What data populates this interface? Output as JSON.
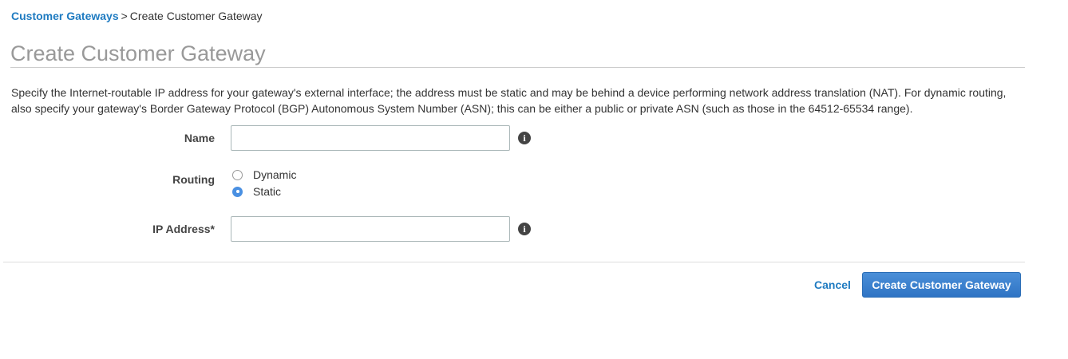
{
  "breadcrumb": {
    "parent": "Customer Gateways",
    "separator": ">",
    "current": "Create Customer Gateway"
  },
  "page": {
    "title": "Create Customer Gateway",
    "description": "Specify the Internet-routable IP address for your gateway's external interface; the address must be static and may be behind a device performing network address translation (NAT). For dynamic routing, also specify your gateway's Border Gateway Protocol (BGP) Autonomous System Number (ASN); this can be either a public or private ASN (such as those in the 64512-65534 range)."
  },
  "form": {
    "name": {
      "label": "Name",
      "value": "",
      "info_icon": "info-icon"
    },
    "routing": {
      "label": "Routing",
      "options": [
        {
          "label": "Dynamic",
          "selected": false
        },
        {
          "label": "Static",
          "selected": true
        }
      ]
    },
    "ip_address": {
      "label": "IP Address*",
      "value": "",
      "info_icon": "info-icon"
    }
  },
  "actions": {
    "cancel_label": "Cancel",
    "submit_label": "Create Customer Gateway"
  },
  "colors": {
    "link": "#1f7bc1",
    "primary_button": "#2f74c4",
    "radio_selected": "#4a90e2",
    "title": "#999999"
  }
}
